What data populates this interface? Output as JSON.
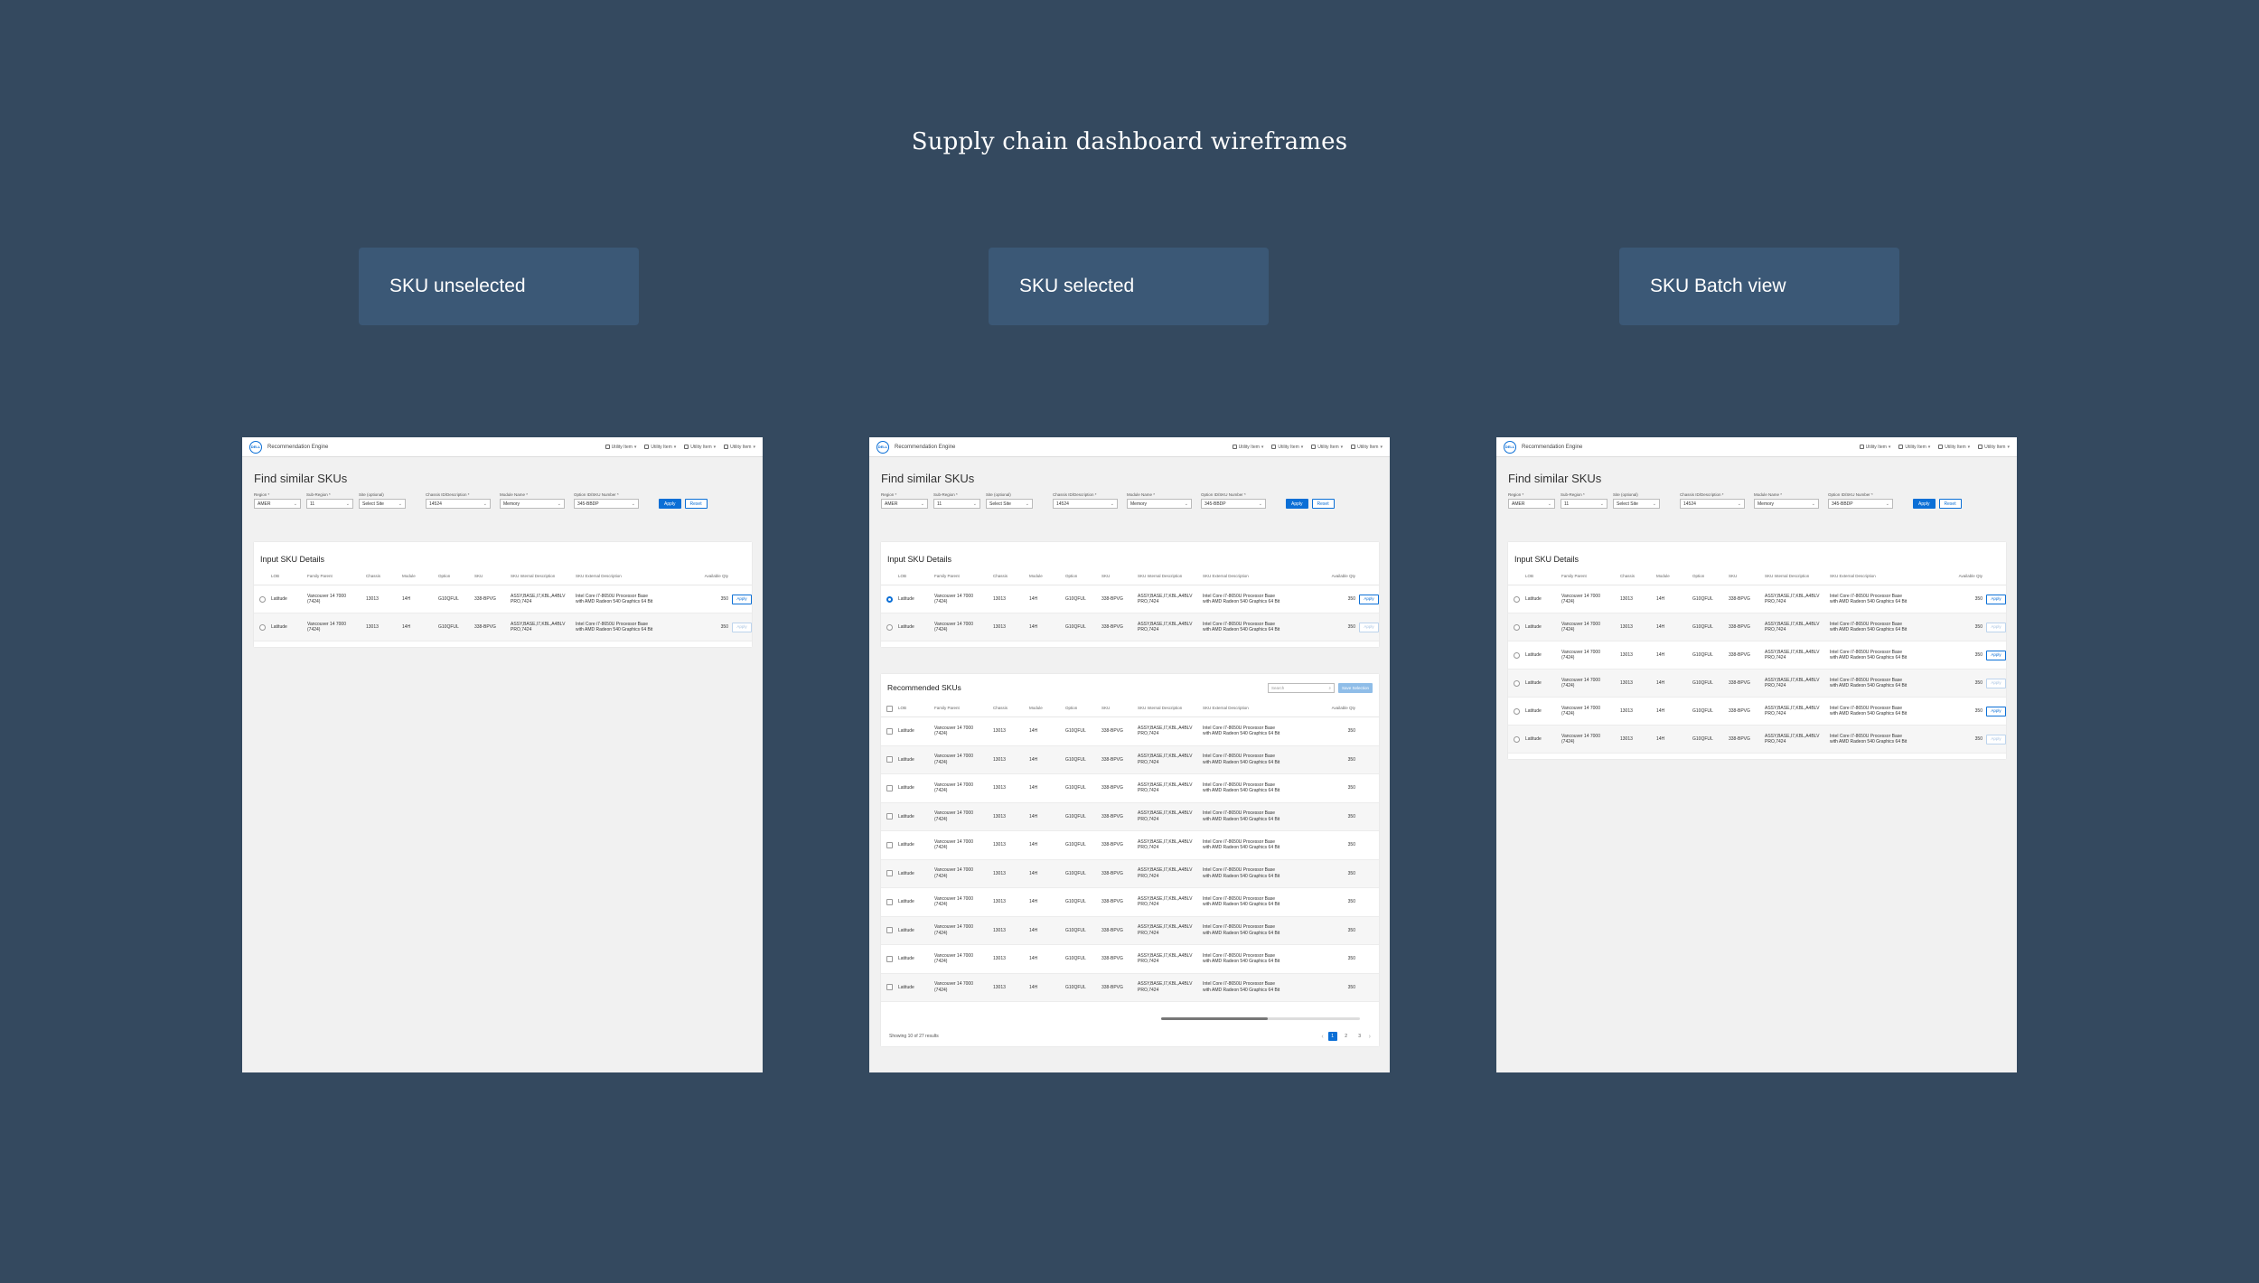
{
  "page": {
    "title": "Supply chain dashboard wireframes"
  },
  "labels": [
    "SKU unselected",
    "SKU selected",
    "SKU Batch view"
  ],
  "app": {
    "logo": "DELL",
    "name": "Recommendation Engine",
    "utilities": [
      "Utility Item",
      "Utility Item",
      "Utility Item",
      "Utility Item"
    ],
    "utility_icons": [
      "bell-icon",
      "cart-icon",
      "user-icon",
      "globe-icon"
    ]
  },
  "find": {
    "title": "Find similar SKUs",
    "filters": [
      {
        "label": "Region *",
        "value": "AMER"
      },
      {
        "label": "Sub-Region *",
        "value": "11"
      },
      {
        "label": "Site (optional)",
        "value": "Select Site"
      },
      {
        "label": "Chassis ID/Description *",
        "value": "14524"
      },
      {
        "label": "Module Name *",
        "value": "Memory"
      },
      {
        "label": "Option ID/SKU Number *",
        "value": "345-BBDP"
      }
    ],
    "apply": "Apply",
    "reset": "Reset"
  },
  "input_sku": {
    "title": "Input SKU Details",
    "columns": [
      "LOB",
      "Family Parent",
      "Chassis",
      "Module",
      "Option",
      "SKU",
      "SKU Internal Description",
      "SKU External Description",
      "Available Qty"
    ]
  },
  "row": {
    "lob": "Latitude",
    "family_l1": "Vancouver 14 7000",
    "family_l2": "(7424)",
    "chassis": "13013",
    "module": "14H",
    "option": "G10QFUL",
    "sku": "338-BPVG",
    "int_l1": "ASSY,BASE,I7,KBL,A4BLV",
    "int_l2": "PRO,7424",
    "ext_l1": "Intel Core i7-8650U Processor Base",
    "ext_l2": "with AMD Radeon 540 Graphics 64 Bit",
    "qty": "350",
    "apply": "Apply"
  },
  "recommended": {
    "title": "Recommended SKUs",
    "search_placeholder": "Search",
    "save_selection": "Save Selection",
    "columns": [
      "LOB",
      "Family Parent",
      "Chassis",
      "Module",
      "Option",
      "SKU",
      "SKU Internal Description",
      "SKU External Description",
      "Available Qty"
    ],
    "showing": "Showing 10 of 27 results",
    "pages": [
      "1",
      "2",
      "3"
    ]
  },
  "colors": {
    "background": "#34495f",
    "label_card": "#3b5876",
    "accent": "#0b6fd6"
  }
}
